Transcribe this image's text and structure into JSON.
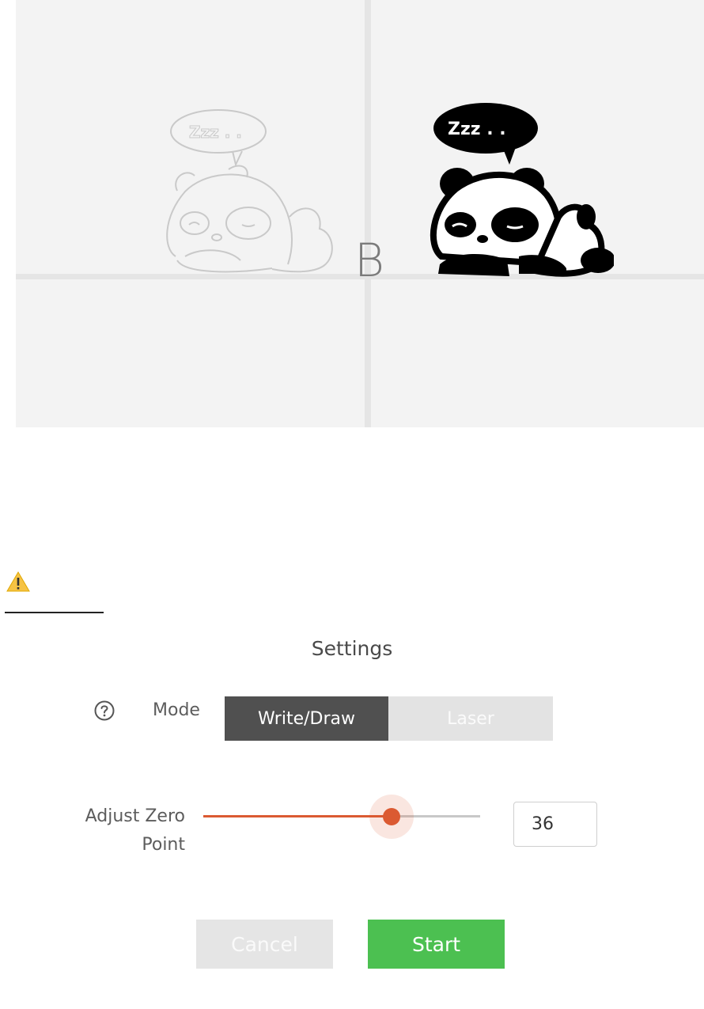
{
  "preview": {
    "point_label": "B",
    "bubble_text": "Zzz . ."
  },
  "settings": {
    "title": "Settings",
    "mode": {
      "label": "Mode",
      "options": [
        "Write/Draw",
        "Laser"
      ],
      "selected": "Write/Draw"
    },
    "zero_point": {
      "label_line1": "Adjust Zero",
      "label_line2": "Point",
      "value": "36",
      "slider_fraction": 0.68
    }
  },
  "buttons": {
    "cancel": "Cancel",
    "start": "Start"
  },
  "colors": {
    "accent": "#db5a32",
    "start": "#4cc051",
    "warning": "#f6c344"
  },
  "icons": {
    "warning": "warning-icon",
    "help": "help-circle-icon"
  }
}
